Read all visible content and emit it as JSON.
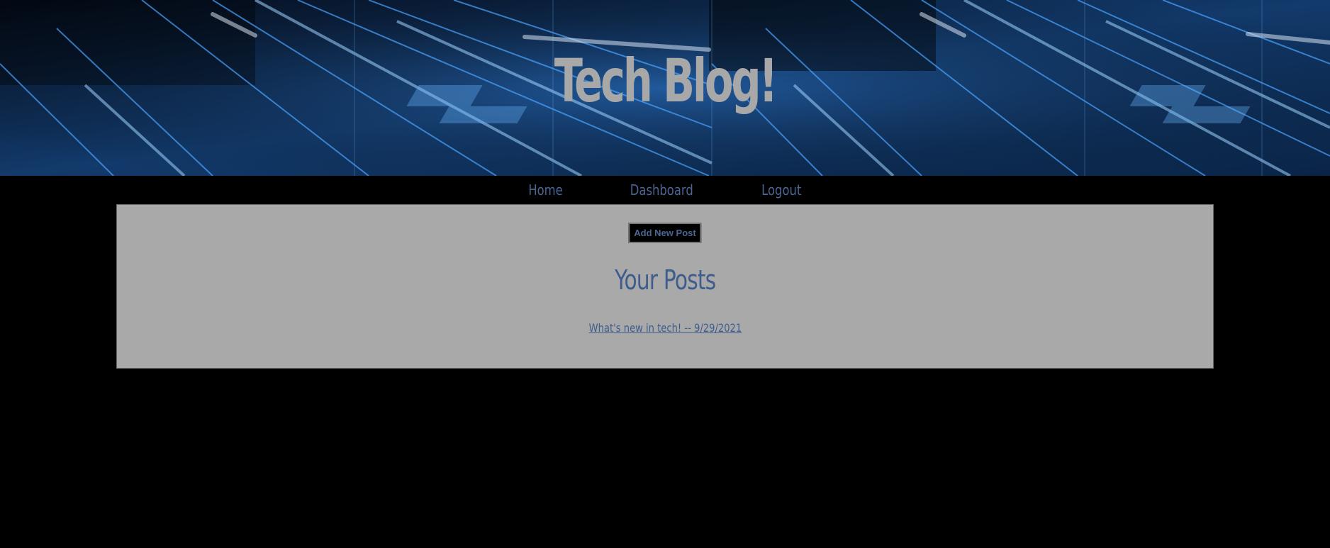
{
  "header": {
    "title": "Tech Blog!"
  },
  "nav": {
    "items": [
      {
        "label": "Home"
      },
      {
        "label": "Dashboard"
      },
      {
        "label": "Logout"
      }
    ]
  },
  "dashboard": {
    "add_button_label": "Add New Post",
    "section_title": "Your Posts",
    "posts": [
      {
        "title": "What's new in tech! -- 9/29/2021"
      }
    ]
  },
  "colors": {
    "page_background": "#000000",
    "panel_background": "#a9a9a9",
    "link_color": "#3f5d8c",
    "title_color": "#a8a8a8",
    "banner_accent": "#3a8fe0"
  },
  "icons": {
    "banner_image": "circuit-board-background"
  }
}
